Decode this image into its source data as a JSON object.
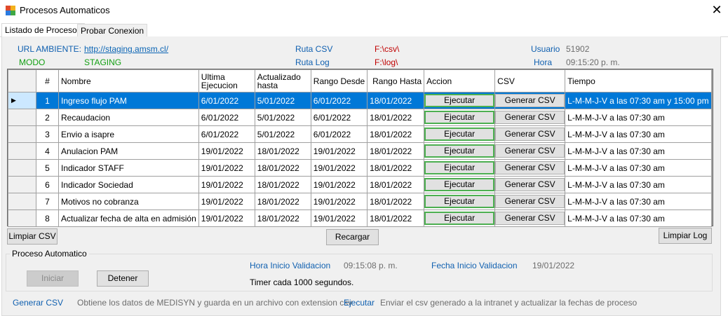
{
  "window": {
    "title": "Procesos Automaticos",
    "close_glyph": "✕"
  },
  "tabs": [
    {
      "label": "Listado de Procesos"
    },
    {
      "label": "Probar Conexion"
    }
  ],
  "info": {
    "url_label": "URL AMBIENTE:",
    "url_value": "http://staging.amsm.cl/",
    "modo_label": "MODO",
    "modo_value": "STAGING",
    "ruta_csv_label": "Ruta CSV",
    "ruta_csv_value": "F:\\csv\\",
    "ruta_log_label": "Ruta Log",
    "ruta_log_value": "F:\\log\\",
    "usuario_label": "Usuario",
    "usuario_value": "51902",
    "hora_label": "Hora",
    "hora_value": "09:15:20 p. m."
  },
  "grid": {
    "row_marker": "▶",
    "columns": [
      "#",
      "Nombre",
      "Ultima Ejecucion",
      "Actualizado hasta",
      "Rango Desde",
      "Rango Hasta",
      "Accion",
      "CSV",
      "Tiempo"
    ],
    "rows": [
      {
        "num": "1",
        "nombre": "Ingreso flujo PAM",
        "ultima": "6/01/2022",
        "actualizado": "5/01/2022",
        "desde": "6/01/2022",
        "hasta": "18/01/2022",
        "accion": "Ejecutar",
        "csv": "Generar CSV",
        "tiempo": "L-M-M-J-V a las 07:30 am y 15:00 pm"
      },
      {
        "num": "2",
        "nombre": "Recaudacion",
        "ultima": "6/01/2022",
        "actualizado": "5/01/2022",
        "desde": "6/01/2022",
        "hasta": "18/01/2022",
        "accion": "Ejecutar",
        "csv": "Generar CSV",
        "tiempo": "L-M-M-J-V a las 07:30 am"
      },
      {
        "num": "3",
        "nombre": "Envio a isapre",
        "ultima": "6/01/2022",
        "actualizado": "5/01/2022",
        "desde": "6/01/2022",
        "hasta": "18/01/2022",
        "accion": "Ejecutar",
        "csv": "Generar CSV",
        "tiempo": "L-M-M-J-V a las 07:30 am"
      },
      {
        "num": "4",
        "nombre": "Anulacion PAM",
        "ultima": "19/01/2022",
        "actualizado": "18/01/2022",
        "desde": "19/01/2022",
        "hasta": "18/01/2022",
        "accion": "Ejecutar",
        "csv": "Generar CSV",
        "tiempo": "L-M-M-J-V a las 07:30 am"
      },
      {
        "num": "5",
        "nombre": "Indicador STAFF",
        "ultima": "19/01/2022",
        "actualizado": "18/01/2022",
        "desde": "19/01/2022",
        "hasta": "18/01/2022",
        "accion": "Ejecutar",
        "csv": "Generar CSV",
        "tiempo": "L-M-M-J-V a las 07:30 am"
      },
      {
        "num": "6",
        "nombre": "Indicador Sociedad",
        "ultima": "19/01/2022",
        "actualizado": "18/01/2022",
        "desde": "19/01/2022",
        "hasta": "18/01/2022",
        "accion": "Ejecutar",
        "csv": "Generar CSV",
        "tiempo": "L-M-M-J-V a las 07:30 am"
      },
      {
        "num": "7",
        "nombre": "Motivos no cobranza",
        "ultima": "19/01/2022",
        "actualizado": "18/01/2022",
        "desde": "19/01/2022",
        "hasta": "18/01/2022",
        "accion": "Ejecutar",
        "csv": "Generar CSV",
        "tiempo": "L-M-M-J-V a las 07:30 am"
      },
      {
        "num": "8",
        "nombre": "Actualizar fecha de alta en admisión",
        "ultima": "19/01/2022",
        "actualizado": "18/01/2022",
        "desde": "19/01/2022",
        "hasta": "18/01/2022",
        "accion": "Ejecutar",
        "csv": "Generar CSV",
        "tiempo": "L-M-M-J-V a las 07:30 am"
      }
    ]
  },
  "buttons": {
    "limpiar_csv": "Limpiar CSV",
    "recargar": "Recargar",
    "limpiar_log": "Limpiar Log",
    "iniciar": "Iniciar",
    "detener": "Detener"
  },
  "proceso": {
    "group_title": "Proceso Automatico",
    "hora_inicio_label": "Hora Inicio Validacion",
    "hora_inicio_value": "09:15:08 p. m.",
    "fecha_inicio_label": "Fecha Inicio Validacion",
    "fecha_inicio_value": "19/01/2022",
    "timer_text": "Timer cada 1000 segundos."
  },
  "footer": {
    "generar_label": "Generar CSV",
    "generar_desc": "Obtiene los datos de MEDISYN y guarda en un archivo con extension csv",
    "ejecutar_label": "Ejecutar",
    "ejecutar_desc": "Enviar el csv generado a la intranet y actualizar la fechas de proceso"
  },
  "colors": {
    "selection": "#0078d7",
    "label_blue": "#1060b0",
    "label_green": "#14a014",
    "path_red": "#c00000",
    "action_border_green": "#4caf50"
  }
}
